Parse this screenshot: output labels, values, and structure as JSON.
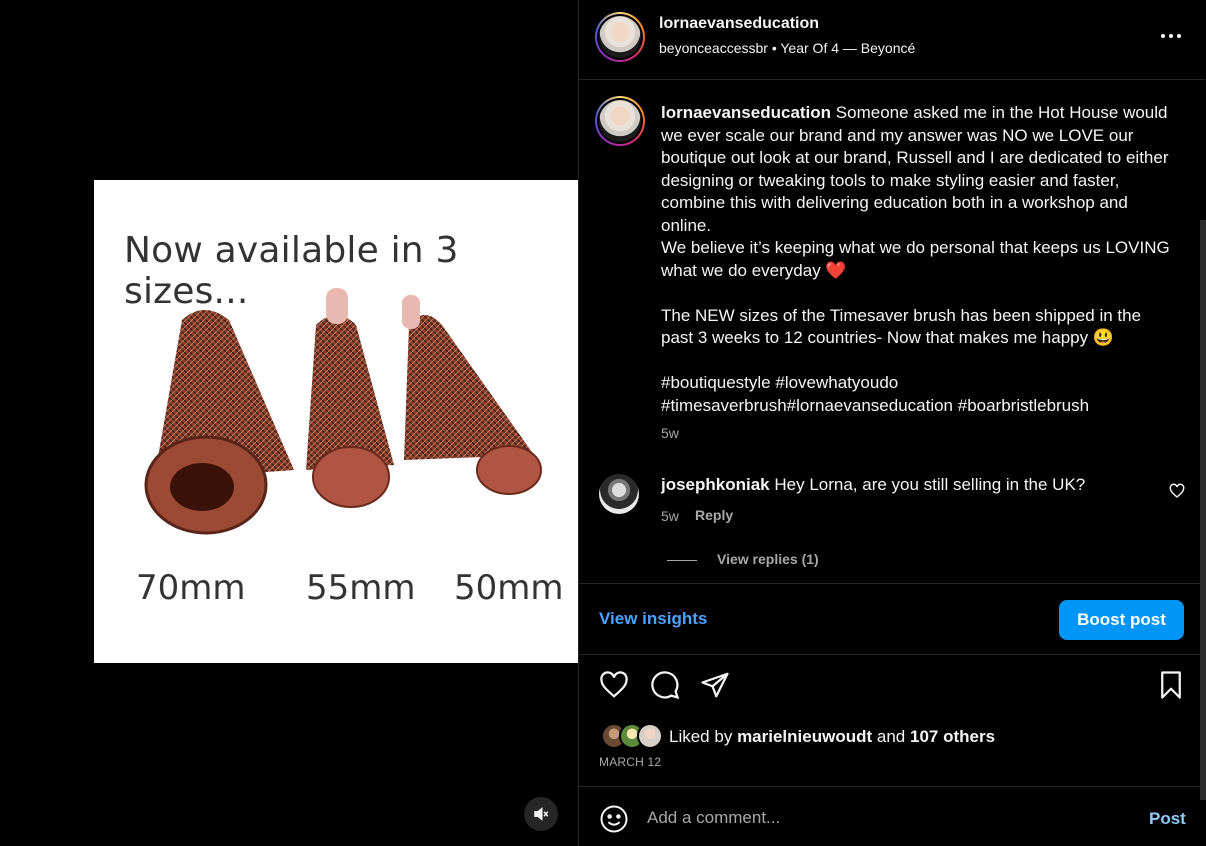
{
  "media": {
    "photo_heading": "Now available in 3 sizes...",
    "sizes": [
      "70mm",
      "55mm",
      "50mm"
    ],
    "mute_icon": "speaker-muted-icon"
  },
  "header": {
    "username": "lornaevanseducation",
    "subtitle": "beyonceaccessbr • Year Of 4 — Beyoncé",
    "more_icon": "more-horizontal-icon"
  },
  "caption": {
    "username": "lornaevanseducation",
    "line1": "Someone asked me in the Hot House would we ever scale our brand and my answer was NO we LOVE our boutique out look at our brand, Russell and I are dedicated to either designing or tweaking tools to make styling easier and faster, combine this with delivering education both in a workshop and online.",
    "line2": "We believe it’s keeping what we do personal that keeps us LOVING what we do everyday ❤️",
    "line3": "The NEW sizes of the Timesaver brush has been shipped in the past 3 weeks to 12 countries- Now that makes me happy 😃",
    "line4": "#boutiquestyle #lovewhatyoudo",
    "line5": "#timesaverbrush#lornaevanseducation #boarbristlebrush",
    "time": "5w"
  },
  "comment": {
    "username": "josephkoniak",
    "text": "Hey Lorna, are you still selling in the UK?",
    "time": "5w",
    "reply_label": "Reply",
    "view_replies": "View replies (1)"
  },
  "insights": {
    "view_label": "View insights",
    "boost_label": "Boost post"
  },
  "likes": {
    "prefix": "Liked by",
    "user": "marielnieuwoudt",
    "and": "and",
    "others": "107 others",
    "date": "MARCH 12"
  },
  "comment_box": {
    "placeholder": "Add a comment...",
    "post_label": "Post"
  },
  "colors": {
    "background": "#000000",
    "accent": "#0095f6",
    "link": "#4aa3ff",
    "muted": "#a8a8a8"
  }
}
